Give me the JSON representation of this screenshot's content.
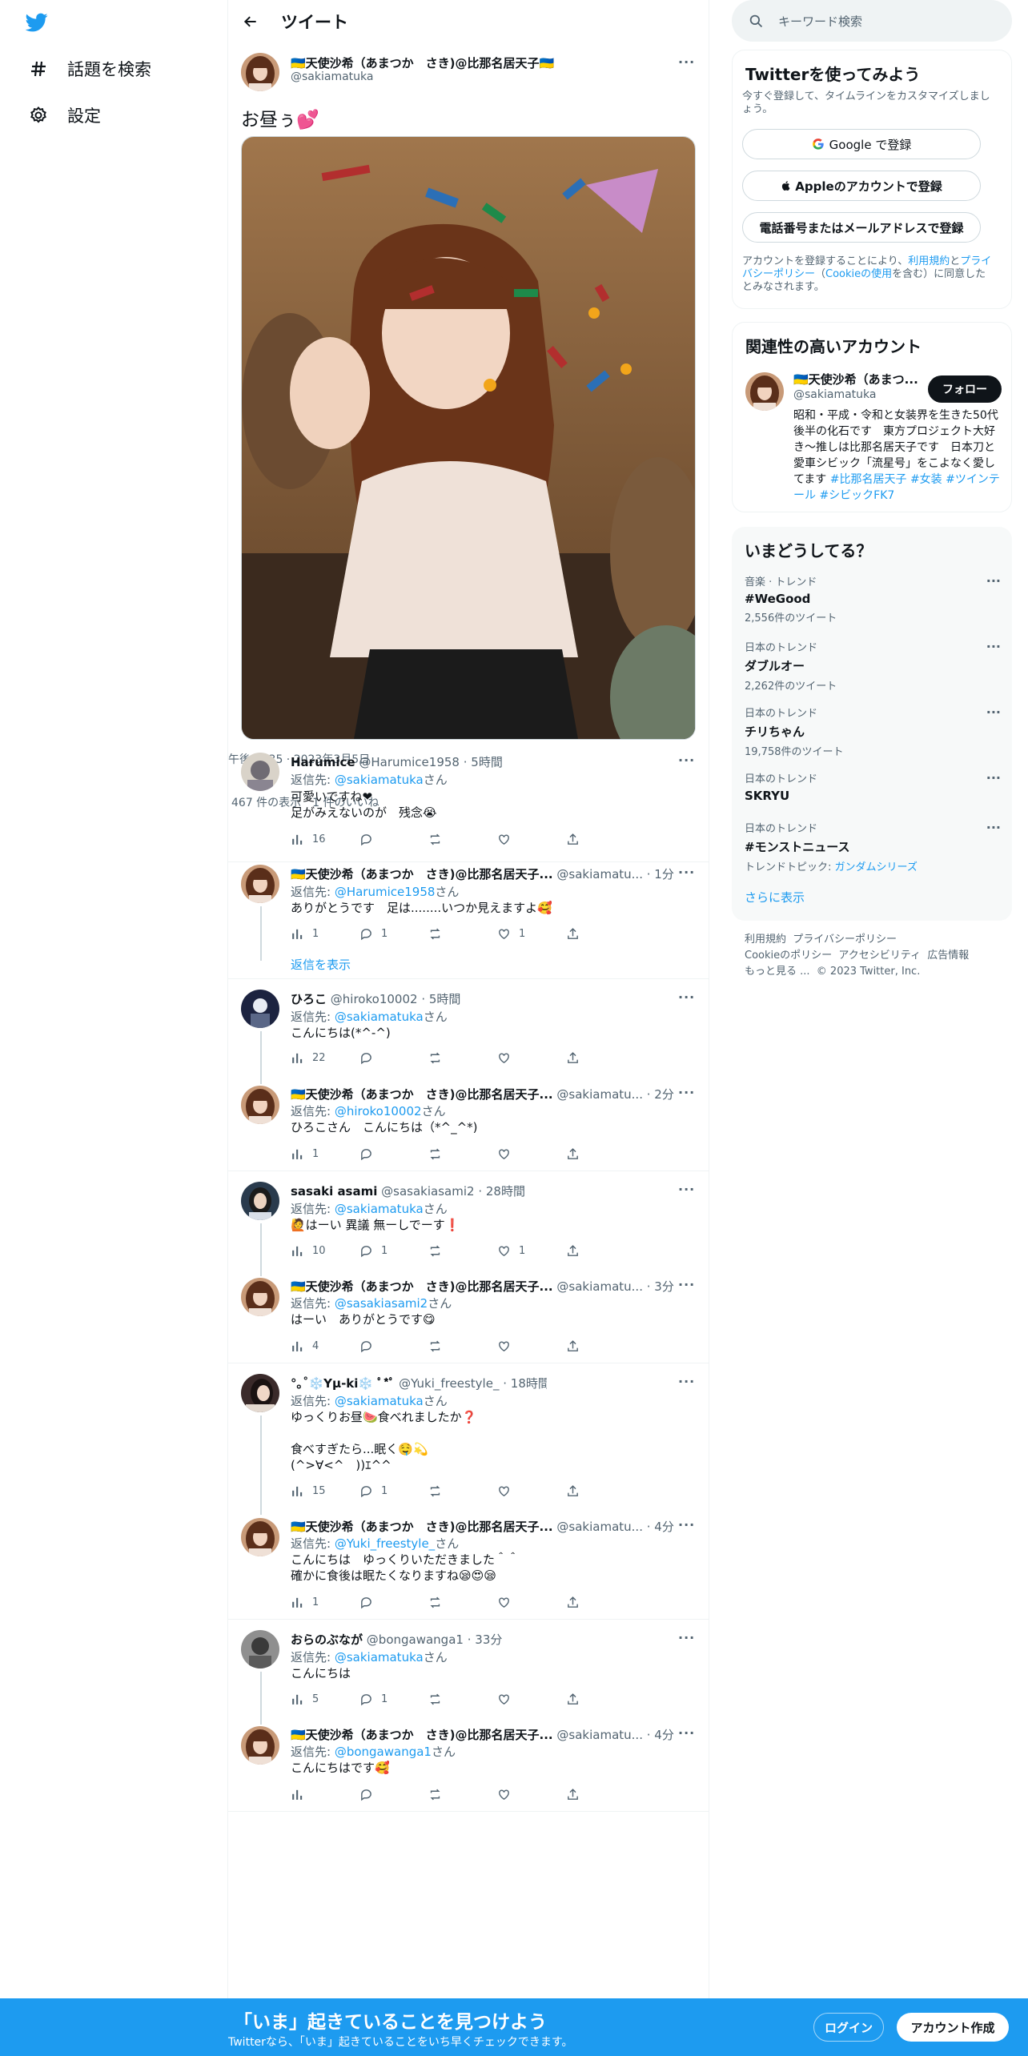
{
  "nav": {
    "explore": "話題を検索",
    "settings": "設定"
  },
  "header": {
    "title": "ツイート"
  },
  "main_tweet": {
    "name": "🇺🇦天使沙希（あまつか　さき)@比那名居天子🇺🇦",
    "handle": "@sakiamatuka",
    "text": "お昼ぅ💕",
    "overlap_text_1": "午後12:35 · 2023年3月5日",
    "overlap_text_2": "467 件の表示　1 件のいいね"
  },
  "replies": [
    {
      "name": "Harumice",
      "handle": "@Harumice1958",
      "time": "· 5時間",
      "reply_prefix": "返信先: ",
      "reply_to": "@sakiamatuka",
      "reply_suffix": "さん",
      "text": "可愛いですね❤\n足がみえないのが　残念😭",
      "views": "16",
      "replies": "",
      "likes": ""
    },
    {
      "name": "🇺🇦天使沙希（あまつか　さき)@比那名居天子...",
      "handle": "@sakiamatu...",
      "time": "· 1分",
      "reply_prefix": "返信先: ",
      "reply_to": "@Harumice1958",
      "reply_suffix": "さん",
      "text": "ありがとうです　足は........いつか見えますよ🥰",
      "views": "1",
      "replies": "1",
      "likes": "1"
    },
    {
      "name": "ひろこ",
      "handle": "@hiroko10002",
      "time": "· 5時間",
      "reply_prefix": "返信先: ",
      "reply_to": "@sakiamatuka",
      "reply_suffix": "さん",
      "text": "こんにちは(*^-^)",
      "views": "22",
      "replies": "",
      "likes": ""
    },
    {
      "name": "🇺🇦天使沙希（あまつか　さき)@比那名居天子...",
      "handle": "@sakiamatu...",
      "time": "· 2分",
      "reply_prefix": "返信先: ",
      "reply_to": "@hiroko10002",
      "reply_suffix": "さん",
      "text": "ひろこさん　こんにちは（*^_^*)",
      "views": "1",
      "replies": "",
      "likes": ""
    },
    {
      "name": "sasaki asami",
      "handle": "@sasakiasami2",
      "time": "· 28時間",
      "reply_prefix": "返信先: ",
      "reply_to": "@sakiamatuka",
      "reply_suffix": "さん",
      "text": "🙋はーい 異議 無ーしでーす❗",
      "views": "10",
      "replies": "1",
      "likes": "1"
    },
    {
      "name": "🇺🇦天使沙希（あまつか　さき)@比那名居天子...",
      "handle": "@sakiamatu...",
      "time": "· 3分",
      "reply_prefix": "返信先: ",
      "reply_to": "@sasakiasami2",
      "reply_suffix": "さん",
      "text": "はーい　ありがとうです😋",
      "views": "4",
      "replies": "",
      "likes": ""
    },
    {
      "name": "°｡˚❄️Yµ-ki❄️ ﾟ*ﾟ",
      "handle": "@Yuki_freestyle_",
      "time": "· 18時間",
      "reply_prefix": "返信先: ",
      "reply_to": "@sakiamatuka",
      "reply_suffix": "さん",
      "text": "ゆっくりお昼🍉食べれましたか❓\n\n食べすぎたら...眠く🤤💫\n(^>∀<^　))ｴ^^",
      "views": "15",
      "replies": "1",
      "likes": ""
    },
    {
      "name": "🇺🇦天使沙希（あまつか　さき)@比那名居天子...",
      "handle": "@sakiamatu...",
      "time": "· 4分",
      "reply_prefix": "返信先: ",
      "reply_to": "@Yuki_freestyle_",
      "reply_suffix": "さん",
      "text": "こんにちは　ゆっくりいただきました＾＾\n確かに食後は眠たくなりますね😪😍😪",
      "views": "1",
      "replies": "",
      "likes": ""
    },
    {
      "name": "おらのぶなが",
      "handle": "@bongawanga1",
      "time": "· 33分",
      "reply_prefix": "返信先: ",
      "reply_to": "@sakiamatuka",
      "reply_suffix": "さん",
      "text": "こんにちは",
      "views": "5",
      "replies": "1",
      "likes": ""
    },
    {
      "name": "🇺🇦天使沙希（あまつか　さき)@比那名居天子...",
      "handle": "@sakiamatu...",
      "time": "· 4分",
      "reply_prefix": "返信先: ",
      "reply_to": "@bongawanga1",
      "reply_suffix": "さん",
      "text": "こんにちはです🥰",
      "views": "",
      "replies": "",
      "likes": ""
    }
  ],
  "show_replies": "返信を表示",
  "search": {
    "placeholder": "キーワード検索"
  },
  "signup": {
    "title": "Twitterを使ってみよう",
    "subtitle": "今すぐ登録して、タイムラインをカスタマイズしましょう。",
    "google": "Google で登録",
    "apple": "Appleのアカウントで登録",
    "phone": "電話番号またはメールアドレスで登録",
    "terms_1": "アカウントを登録することにより、",
    "terms_link1": "利用規約",
    "terms_2": "と",
    "terms_link2": "プライバシーポリシー",
    "terms_3": "（",
    "terms_link3": "Cookieの使用",
    "terms_4": "を含む）に同意したとみなされます。"
  },
  "related": {
    "title": "関連性の高いアカウント",
    "name": "🇺🇦天使沙希（あまつ...",
    "handle": "@sakiamatuka",
    "follow": "フォロー",
    "bio": "昭和・平成・令和と女装界を生きた50代後半の化石です　東方プロジェクト大好き～推しは比那名居天子です　日本刀と愛車シビック「流星号」をこよなく愛してます ",
    "tags": "#比那名居天子 #女装 #ツインテール #シビックFK7"
  },
  "trends": {
    "title": "いまどうしてる？",
    "items": [
      {
        "category": "音楽 · トレンド",
        "name": "#WeGood",
        "count": "2,556件のツイート"
      },
      {
        "category": "日本のトレンド",
        "name": "ダブルオー",
        "count": "2,262件のツイート"
      },
      {
        "category": "日本のトレンド",
        "name": "チリちゃん",
        "count": "19,758件のツイート"
      },
      {
        "category": "日本のトレンド",
        "name": "SKRYU",
        "count": ""
      },
      {
        "category": "日本のトレンド",
        "name": "#モンストニュース",
        "count": "トレンドトピック: ",
        "topic": "ガンダムシリーズ"
      }
    ],
    "show_more": "さらに表示"
  },
  "footer": {
    "terms": "利用規約",
    "privacy": "プライバシーポリシー",
    "cookie": "Cookieのポリシー",
    "accessibility": "アクセシビリティ",
    "ads": "広告情報",
    "more": "もっと見る ...",
    "copyright": "© 2023 Twitter, Inc."
  },
  "bottom": {
    "headline": "「いま」起きていることを見つけよう",
    "sub": "Twitterなら、「いま」起きていることをいち早くチェックできます。",
    "login": "ログイン",
    "signup": "アカウント作成"
  },
  "colors": {
    "accent": "#1d9bf0",
    "text": "#0f1419",
    "secondary": "#536471"
  }
}
